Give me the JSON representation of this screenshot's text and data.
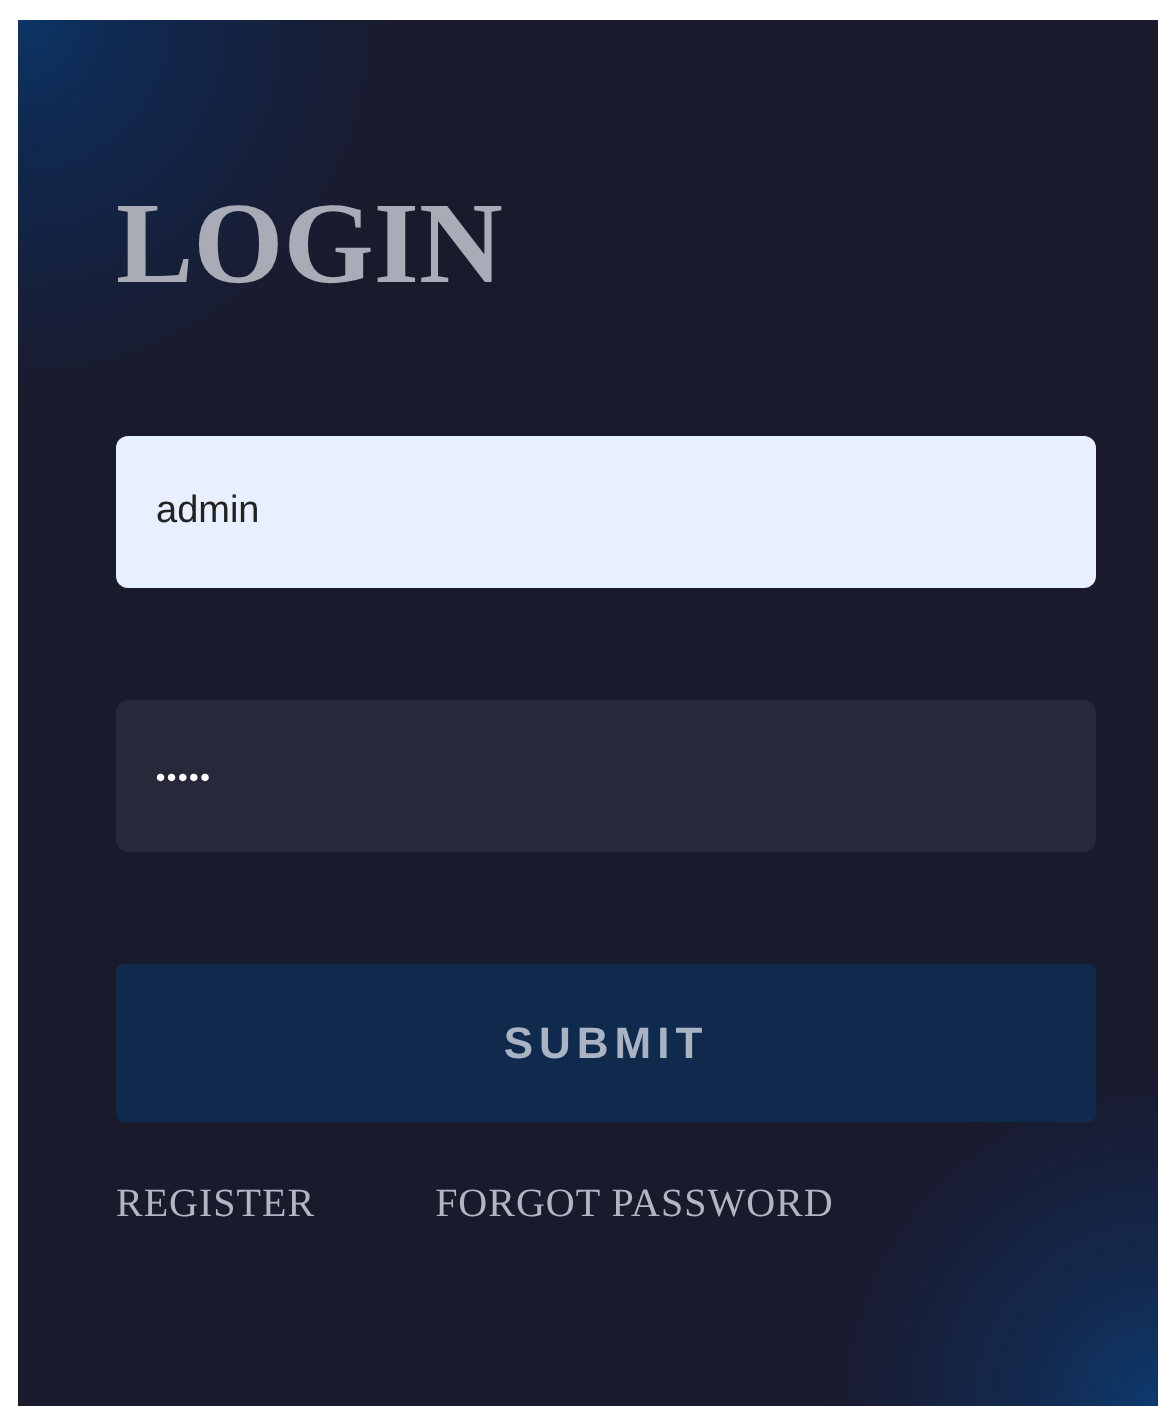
{
  "title": "LOGIN",
  "fields": [
    {
      "kind": "text",
      "value": "admin",
      "focused": true
    },
    {
      "kind": "password",
      "value": "•••••",
      "focused": false
    }
  ],
  "submit": "SUBMIT",
  "links": [
    "REGISTER",
    "FORGOT PASSWORD"
  ]
}
